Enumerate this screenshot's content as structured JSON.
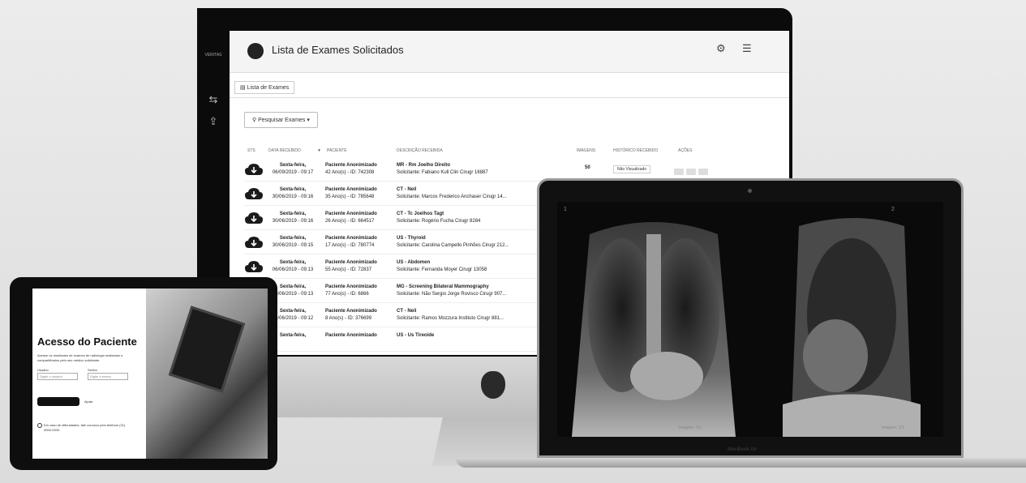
{
  "desktop": {
    "app_title": "Lista de Exames Solicitados",
    "sidebar_logo": "VERITAS",
    "tab_label": "Lista de Exames",
    "search_button": "Pesquisar Exames ▾",
    "columns": [
      "STS",
      "DATA RECEBIDO",
      "PACIENTE",
      "DESCRIÇÃO RECEBIDA",
      "IMAGENS",
      "HISTÓRICO RECEBIDO",
      "AÇÕES"
    ],
    "rows": [
      {
        "date1": "Sexta-feira,",
        "date2": "06/09/2019 - 09:17",
        "pat1": "Paciente Anonimizado",
        "pat2": "42 Ano(s) - ID: 742308",
        "desc1": "MR - Rm Joelho Direito",
        "desc2": "Solicitante: Fabiano Kull Clin Cirugr 16887",
        "images": "50",
        "status": "Não Visualizado"
      },
      {
        "date1": "Sexta-feira,",
        "date2": "30/06/2019 - 09:16",
        "pat1": "Paciente Anonimizado",
        "pat2": "35 Ano(s) - ID: 785648",
        "desc1": "CT - Neil",
        "desc2": "Solicitante: Marcos Frederico Anchaser Cirugr 14...",
        "images": "",
        "status": ""
      },
      {
        "date1": "Sexta-feira,",
        "date2": "30/06/2019 - 09:16",
        "pat1": "Paciente Anonimizado",
        "pat2": "26 Ano(s) - ID: 664517",
        "desc1": "CT - Tc Joelhos Tagt",
        "desc2": "Solicitante: Rogério Fucha Cirugr 8284",
        "images": "",
        "status": ""
      },
      {
        "date1": "Sexta-feira,",
        "date2": "30/06/2019 - 09:15",
        "pat1": "Paciente Anonimizado",
        "pat2": "17 Ano(s) - ID: 780774",
        "desc1": "US - Thyroid",
        "desc2": "Solicitante: Carolina Campello Pinhões Cirugr 212...",
        "images": "",
        "status": ""
      },
      {
        "date1": "Sexta-feira,",
        "date2": "06/06/2019 - 09:13",
        "pat1": "Paciente Anonimizado",
        "pat2": "55 Ano(s) - ID: 72837",
        "desc1": "US - Abdomen",
        "desc2": "Solicitante: Fernanda Moyer Cirugr 13058",
        "images": "",
        "status": ""
      },
      {
        "date1": "Sexta-feira,",
        "date2": "30/06/2019 - 09:13",
        "pat1": "Paciente Anonimizado",
        "pat2": "77 Ano(s) - ID: 6866",
        "desc1": "MG - Screening Bilateral Mammography",
        "desc2": "Solicitante: Não Sergio Jorge Rovisco Cirugr 907...",
        "images": "",
        "status": ""
      },
      {
        "date1": "Sexta-feira,",
        "date2": "06/06/2019 - 09:12",
        "pat1": "Paciente Anonimizado",
        "pat2": "8 Ano(s) - ID: 376699",
        "desc1": "CT - Neil",
        "desc2": "Solicitante: Ramos Mozzura Instituto Cirugr 881...",
        "images": "",
        "status": ""
      },
      {
        "date1": "Sexta-feira,",
        "date2": "",
        "pat1": "Paciente Anonimizado",
        "pat2": "",
        "desc1": "US - Us Tireoide",
        "desc2": "",
        "images": "",
        "status": ""
      }
    ]
  },
  "tablet": {
    "title": "Acesso do Paciente",
    "subtitle": "Acesse os resultados de exames de radiologia realizados e compartilhados pelo seu médico solicitante.",
    "label_user": "Usuário",
    "label_pass": "Senha",
    "placeholder_user": "Digite o usuário",
    "placeholder_pass": "Digite a senha",
    "link": "Ajuda",
    "footer": "Em caso de dificuldades, fale conosco pelo telefone (31) 3000-0000."
  },
  "laptop": {
    "brand": "MacBook Air",
    "viewer_left_number": "1",
    "viewer_right_number": "2",
    "caption_left": "Imagem: 1/1",
    "caption_right": "Imagem: 1/1"
  }
}
